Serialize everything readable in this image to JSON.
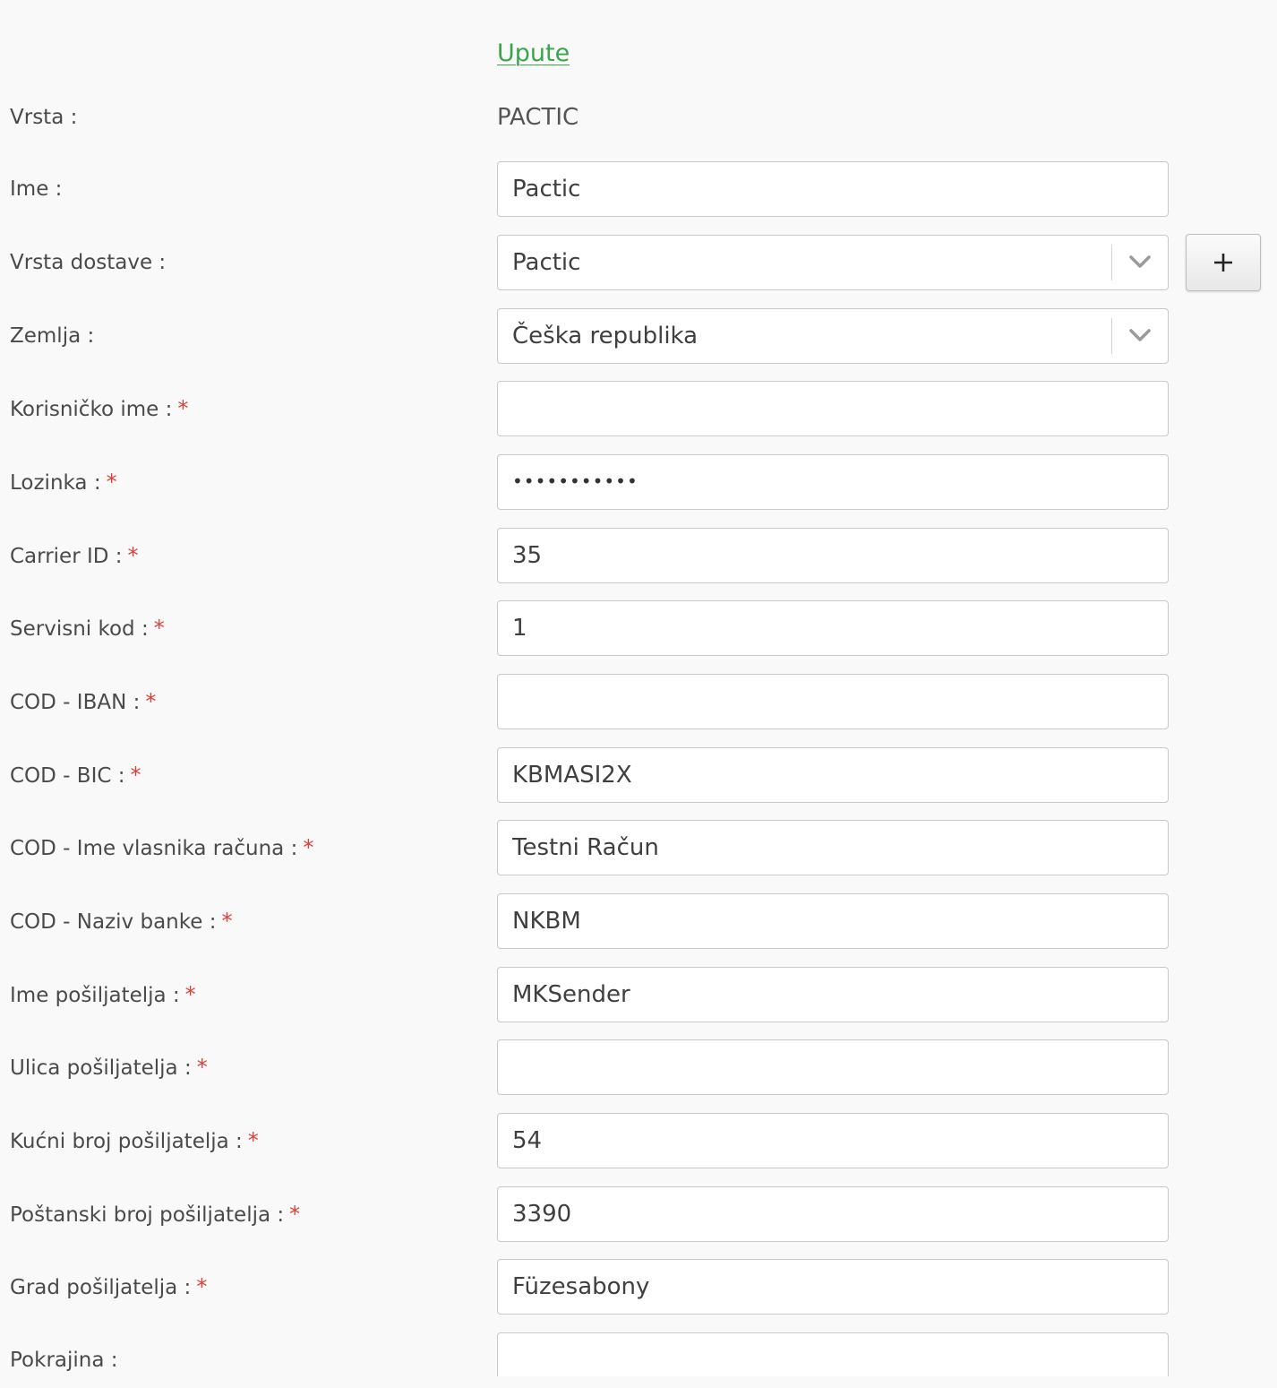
{
  "help_link": "Upute",
  "vrsta": {
    "label": "Vrsta :",
    "value": "PACTIC"
  },
  "ime": {
    "label": "Ime :",
    "value": "Pactic"
  },
  "vrsta_dostave": {
    "label": "Vrsta dostave :",
    "selected": "Pactic",
    "add_button_symbol": "+"
  },
  "zemlja": {
    "label": "Zemlja :",
    "selected": "Češka republika"
  },
  "korisnicko_ime": {
    "label": "Korisničko ime :",
    "required": "*",
    "value": ""
  },
  "lozinka": {
    "label": "Lozinka :",
    "required": "*",
    "masked": "•••••••••••"
  },
  "carrier_id": {
    "label": "Carrier ID :",
    "required": "*",
    "value": "35"
  },
  "servisni_kod": {
    "label": "Servisni kod :",
    "required": "*",
    "value": "1"
  },
  "cod_iban": {
    "label": "COD - IBAN :",
    "required": "*",
    "value": ""
  },
  "cod_bic": {
    "label": "COD - BIC :",
    "required": "*",
    "value": "KBMASI2X"
  },
  "cod_ime_vlasnika": {
    "label": "COD - Ime vlasnika računa :",
    "required": "*",
    "value": "Testni Račun"
  },
  "cod_naziv_banke": {
    "label": "COD - Naziv banke :",
    "required": "*",
    "value": "NKBM"
  },
  "ime_posiljatelja": {
    "label": "Ime pošiljatelja :",
    "required": "*",
    "value": "MKSender"
  },
  "ulica_posiljatelja": {
    "label": "Ulica pošiljatelja :",
    "required": "*",
    "value": ""
  },
  "kucni_broj": {
    "label": "Kućni broj pošiljatelja :",
    "required": "*",
    "value": "54"
  },
  "postanski_broj": {
    "label": "Poštanski broj pošiljatelja :",
    "required": "*",
    "value": "3390"
  },
  "grad_posiljatelja": {
    "label": "Grad pošiljatelja :",
    "required": "*",
    "value": "Füzesabony"
  },
  "pokrajina": {
    "label": "Pokrajina :",
    "value": ""
  },
  "colors": {
    "link": "#3aa54a",
    "required": "#e0413a",
    "background": "#f9f9f9",
    "field_border": "#c9c9c9"
  }
}
